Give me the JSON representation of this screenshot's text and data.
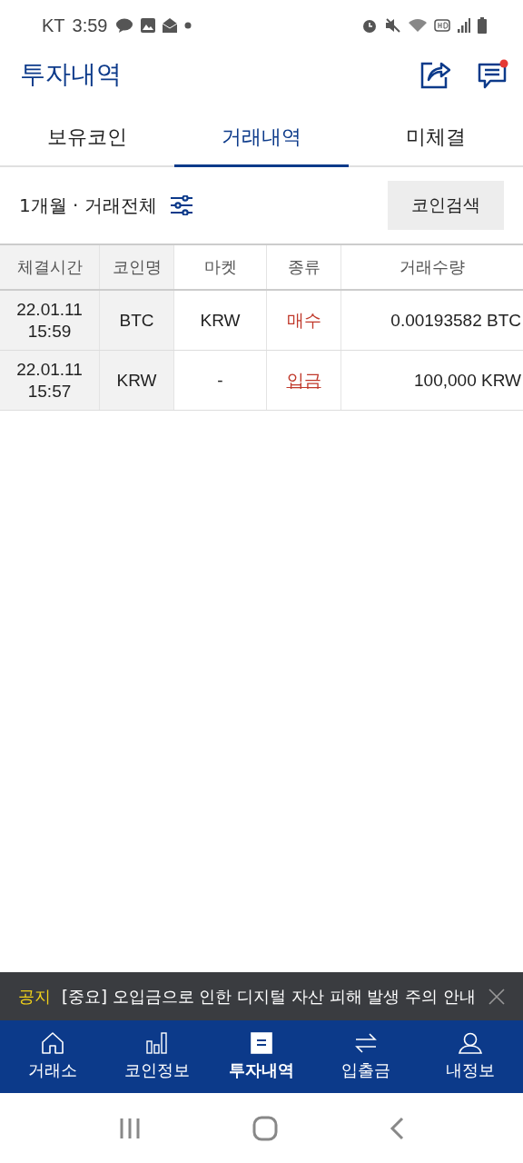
{
  "status_bar": {
    "carrier": "KT",
    "time": "3:59"
  },
  "header": {
    "title": "투자내역",
    "notification_dot": true
  },
  "tabs": [
    {
      "label": "보유코인",
      "selected": false
    },
    {
      "label": "거래내역",
      "selected": true
    },
    {
      "label": "미체결",
      "selected": false
    }
  ],
  "filter": {
    "label": "1개월 · 거래전체",
    "search_button": "코인검색"
  },
  "table": {
    "columns": [
      "체결시간",
      "코인명",
      "마켓",
      "종류",
      "거래수량"
    ],
    "rows": [
      {
        "date": "22.01.11",
        "time": "15:59",
        "coin": "BTC",
        "market": "KRW",
        "type": "매수",
        "kind": "trade",
        "amount": "0.00193582 BTC"
      },
      {
        "date": "22.01.11",
        "time": "15:57",
        "coin": "KRW",
        "market": "-",
        "type": "입금",
        "kind": "link",
        "amount": "100,000 KRW"
      }
    ]
  },
  "notice": {
    "tag": "공지",
    "text": "[중요] 오입금으로 인한 디지털 자산 피해 발생 주의 안내"
  },
  "bottom_nav": [
    {
      "label": "거래소",
      "kind": "home",
      "selected": false
    },
    {
      "label": "코인정보",
      "kind": "chart",
      "selected": false
    },
    {
      "label": "투자내역",
      "kind": "list",
      "selected": true
    },
    {
      "label": "입출금",
      "kind": "transfer",
      "selected": false
    },
    {
      "label": "내정보",
      "kind": "person",
      "selected": false
    }
  ]
}
